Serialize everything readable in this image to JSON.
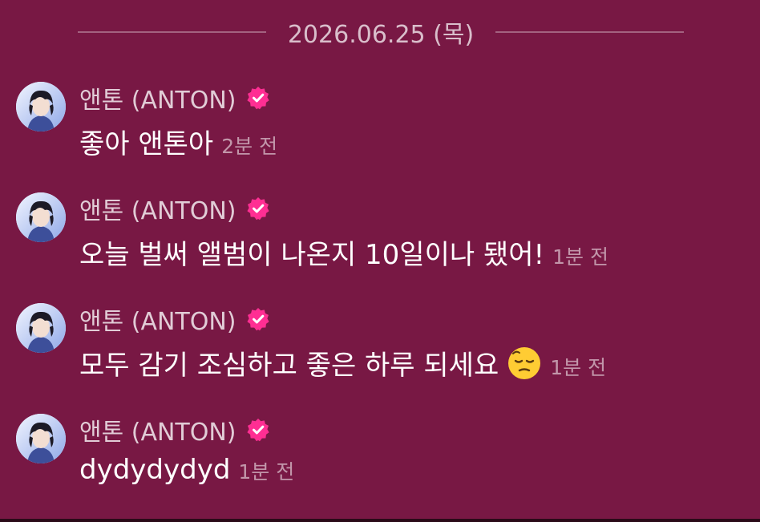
{
  "date_separator": "2026.06.25 (목)",
  "sender": {
    "name": "앤톤 (ANTON)",
    "verified_icon": "verified-badge-icon",
    "badge_color": "#ff2e93"
  },
  "messages": [
    {
      "text": "좋아 앤톤아",
      "time": "2분 전",
      "emoji": null
    },
    {
      "text": "오늘 벌써 앨범이 나온지 10일이나 됐어!",
      "time": "1분 전",
      "emoji": null
    },
    {
      "text": "모두 감기 조심하고 좋은 하루 되세요",
      "time": "1분 전",
      "emoji": "pensive-face-emoji"
    },
    {
      "text": "dydydydyd",
      "time": "1분 전",
      "emoji": null
    }
  ],
  "colors": {
    "background": "#781844",
    "message_text": "#ffffff"
  }
}
